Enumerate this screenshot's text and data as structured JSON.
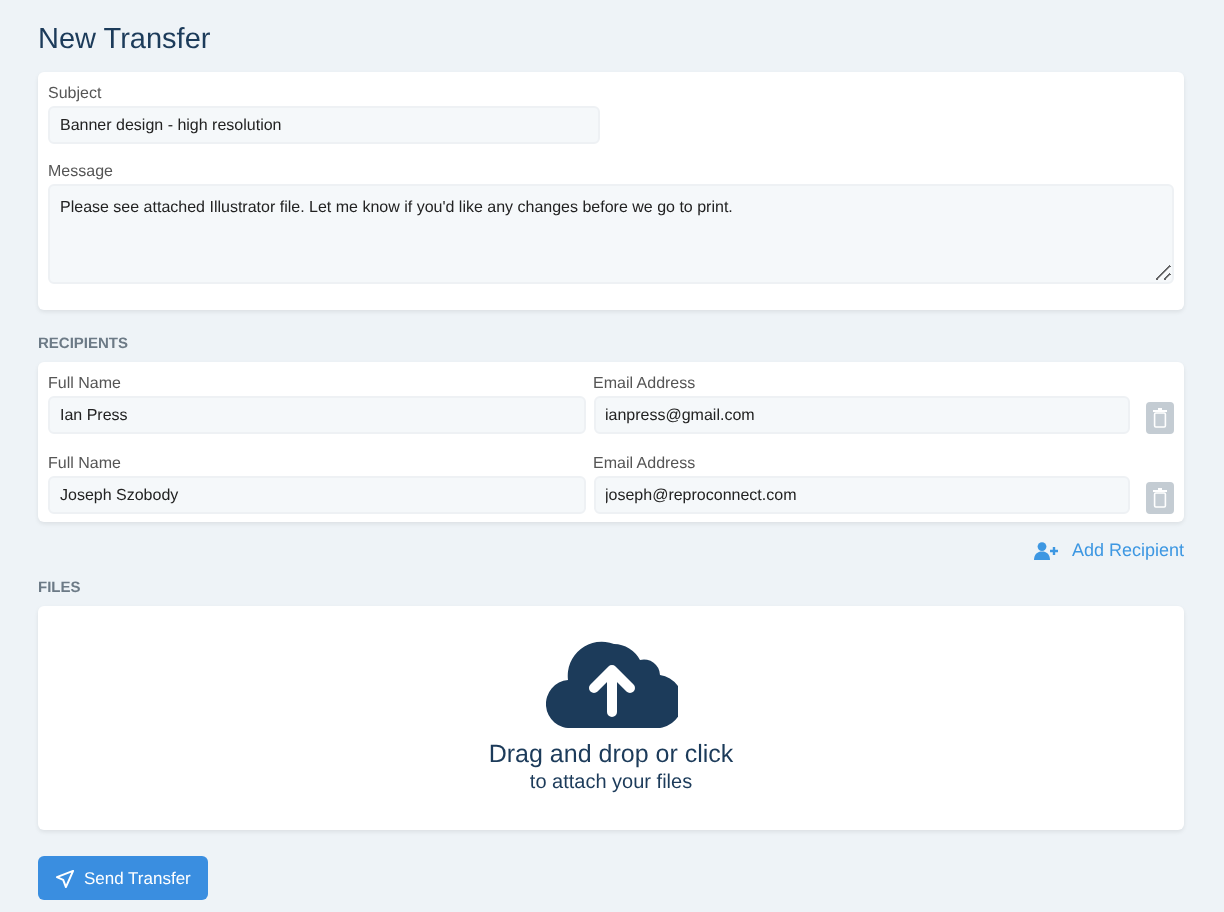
{
  "title": "New Transfer",
  "subject": {
    "label": "Subject",
    "value": "Banner design - high resolution"
  },
  "message": {
    "label": "Message",
    "value": "Please see attached Illustrator file. Let me know if you'd like any changes before we go to print."
  },
  "recipients_heading": "RECIPIENTS",
  "recipients": [
    {
      "name_label": "Full Name",
      "name": "Ian Press",
      "email_label": "Email Address",
      "email": "ianpress@gmail.com"
    },
    {
      "name_label": "Full Name",
      "name": "Joseph Szobody",
      "email_label": "Email Address",
      "email": "joseph@reproconnect.com"
    }
  ],
  "add_recipient": "Add Recipient",
  "files_heading": "FILES",
  "dropzone": {
    "title": "Drag and drop or click",
    "subtitle": "to attach your files"
  },
  "send_button": "Send Transfer"
}
